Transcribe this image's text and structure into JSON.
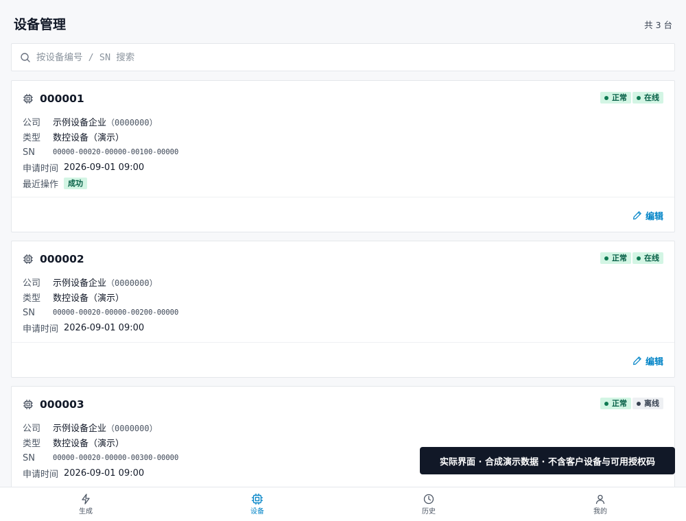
{
  "header": {
    "title": "设备管理",
    "count": "共 3 台"
  },
  "search": {
    "placeholder": "按设备编号 / SN 搜索"
  },
  "labels": {
    "company": "公司",
    "type": "类型",
    "sn": "SN",
    "apply_time": "申请时间",
    "last_op": "最近操作",
    "edit": "编辑"
  },
  "devices": [
    {
      "id": "000001",
      "status": "正常",
      "online": "在线",
      "company": "示例设备企业",
      "company_code": "（0000000）",
      "type": "数控设备（演示）",
      "sn": "00000-00020-00000-00100-00000",
      "apply_time": "2026-09-01 09:00",
      "last_op": "成功"
    },
    {
      "id": "000002",
      "status": "正常",
      "online": "在线",
      "company": "示例设备企业",
      "company_code": "（0000000）",
      "type": "数控设备（演示）",
      "sn": "00000-00020-00000-00200-00000",
      "apply_time": "2026-09-01 09:00"
    },
    {
      "id": "000003",
      "status": "正常",
      "online": "离线",
      "company": "示例设备企业",
      "company_code": "（0000000）",
      "type": "数控设备（演示）",
      "sn": "00000-00020-00000-00300-00000",
      "apply_time": "2026-09-01 09:00"
    }
  ],
  "toast": "实际界面 · 合成演示数据 · 不含客户设备与可用授权码",
  "tabbar": [
    {
      "label": "生成",
      "icon": "lightning-icon"
    },
    {
      "label": "设备",
      "icon": "chip-icon",
      "active": true
    },
    {
      "label": "历史",
      "icon": "clock-icon"
    },
    {
      "label": "我的",
      "icon": "user-icon"
    }
  ],
  "colors": {
    "accent": "#0284c7",
    "success_bg": "#d3f5e4",
    "success_text": "#065f46",
    "toast_bg": "#111827"
  }
}
